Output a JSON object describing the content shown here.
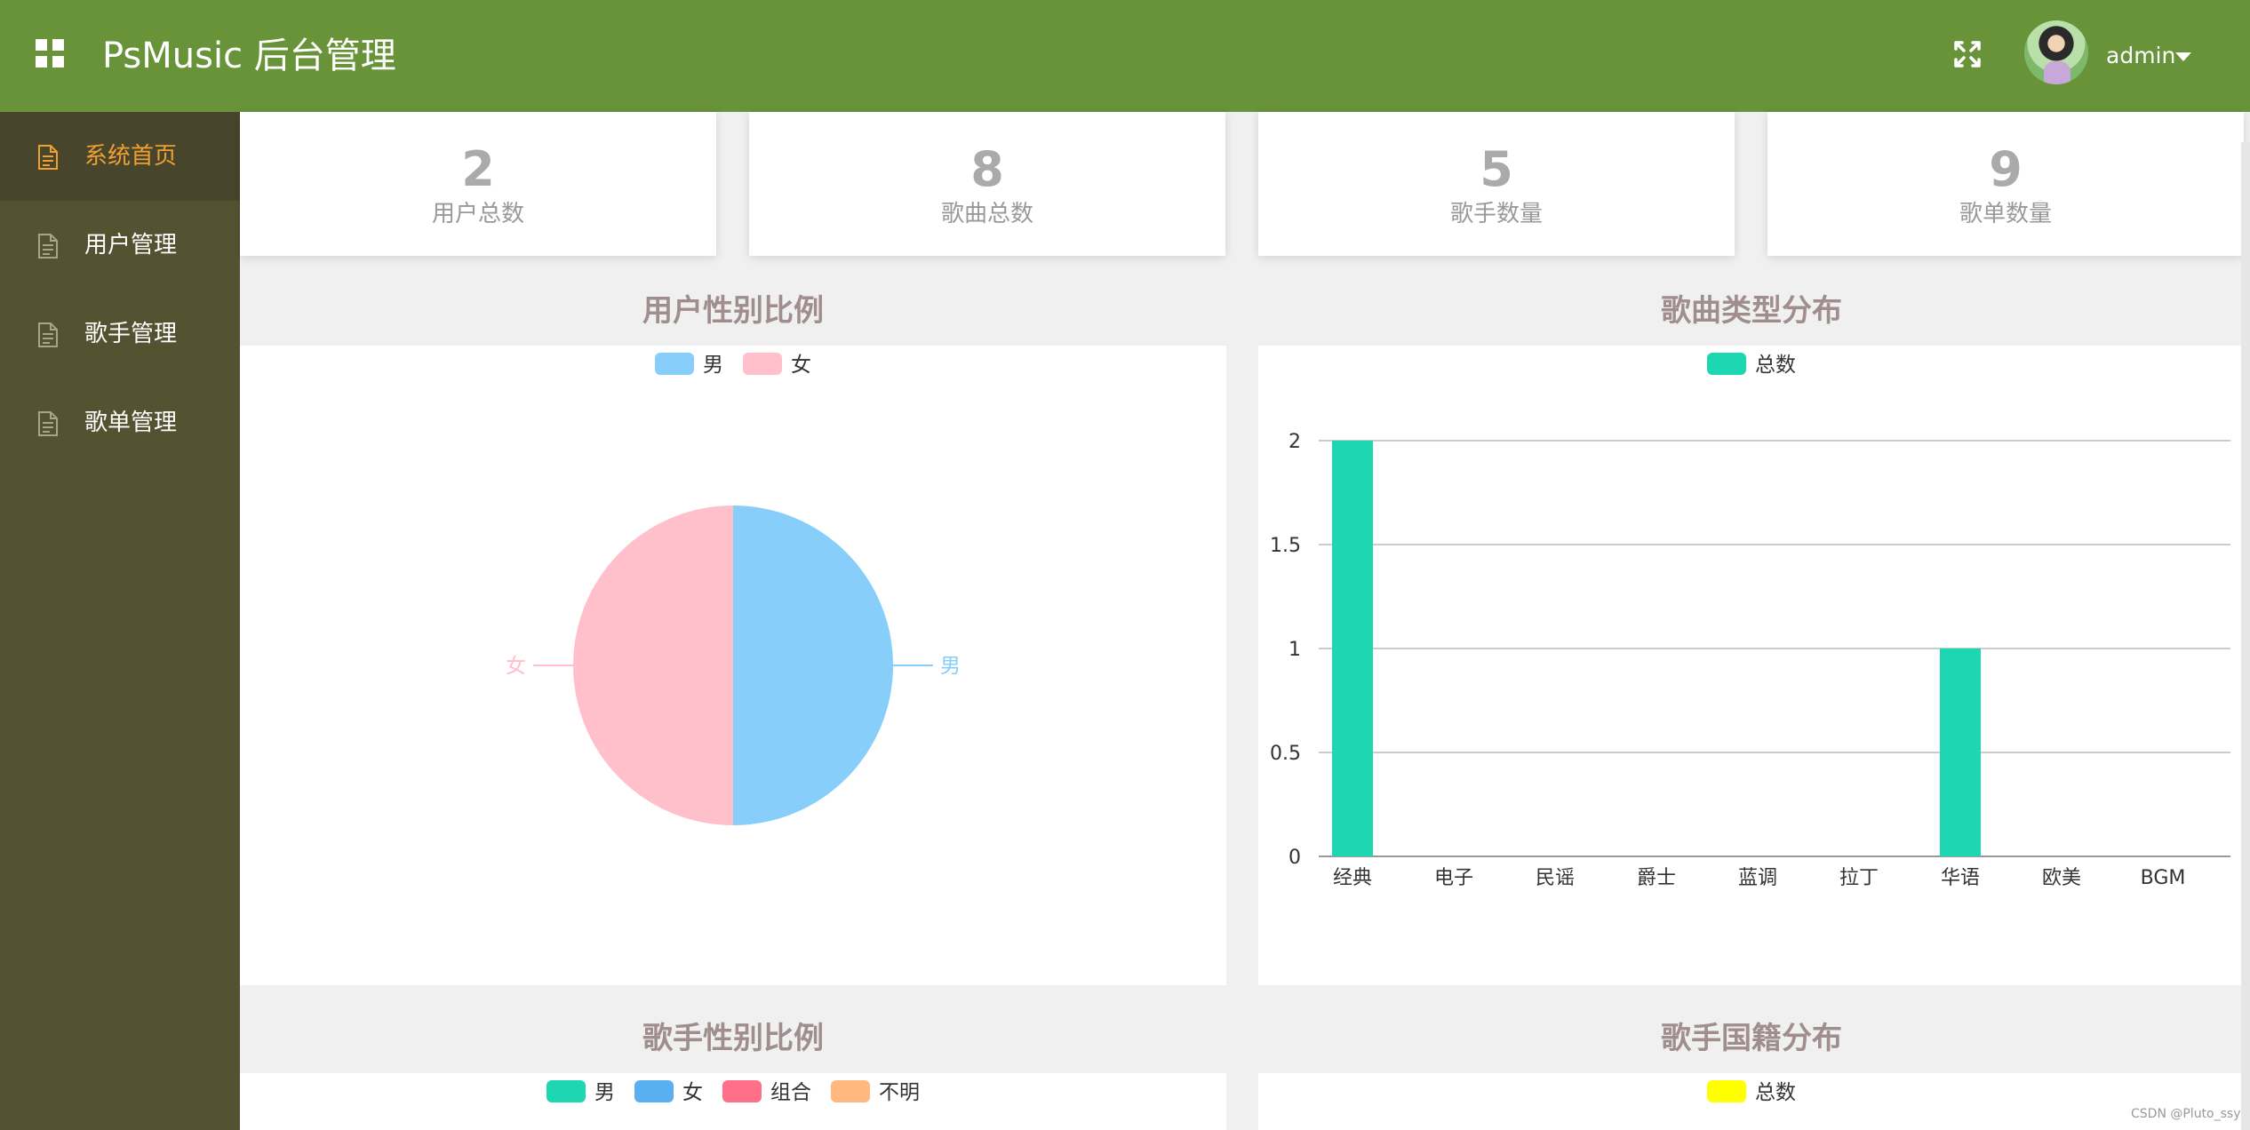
{
  "header": {
    "title": "PsMusic 后台管理",
    "user": "admin",
    "bg_color": "#689339",
    "menu_icon": "grid-icon",
    "fullscreen_icon": "fullscreen-icon"
  },
  "sidebar": {
    "bg_color": "#555231",
    "active_color": "#f0a030",
    "items": [
      {
        "label": "系统首页",
        "active": true,
        "icon": "document-icon"
      },
      {
        "label": "用户管理",
        "active": false,
        "icon": "document-icon"
      },
      {
        "label": "歌手管理",
        "active": false,
        "icon": "document-icon"
      },
      {
        "label": "歌单管理",
        "active": false,
        "icon": "document-icon"
      }
    ]
  },
  "stats": [
    {
      "value": "2",
      "label": "用户总数"
    },
    {
      "value": "8",
      "label": "歌曲总数"
    },
    {
      "value": "5",
      "label": "歌手数量"
    },
    {
      "value": "9",
      "label": "歌单数量"
    }
  ],
  "panels": {
    "user_gender": {
      "title": "用户性别比例"
    },
    "song_type": {
      "title": "歌曲类型分布"
    },
    "singer_gender": {
      "title": "歌手性别比例"
    },
    "singer_country": {
      "title": "歌手国籍分布"
    }
  },
  "watermark": "CSDN @Pluto_ssy",
  "chart_data": [
    {
      "type": "pie",
      "labels": [
        "男",
        "女"
      ],
      "values": [
        1,
        1
      ],
      "colors": [
        "#87cefa",
        "#ffc0cb"
      ],
      "legend": "top-center"
    },
    {
      "type": "bar",
      "categories": [
        "经典",
        "电子",
        "民谣",
        "爵士",
        "蓝调",
        "拉丁",
        "华语",
        "欧美",
        "BGM"
      ],
      "series": [
        {
          "name": "总数",
          "values": [
            2,
            0,
            0,
            0,
            0,
            0,
            1,
            0,
            0
          ],
          "color": "#1dd6b2"
        }
      ],
      "yticks": [
        "0",
        "0.5",
        "1",
        "1.5",
        "2"
      ],
      "ylim": [
        0,
        2
      ],
      "grid": true,
      "legend": "top-center"
    },
    {
      "type": "pie",
      "labels": [
        "男",
        "女",
        "组合",
        "不明"
      ],
      "colors": [
        "#1dd6b2",
        "#5aaff0",
        "#ff7088",
        "#ffb980"
      ],
      "legend": "top-center",
      "note": ""
    },
    {
      "type": "bar",
      "series": [
        {
          "name": "总数",
          "color": "#ffff00"
        }
      ],
      "legend": "top-center"
    }
  ]
}
